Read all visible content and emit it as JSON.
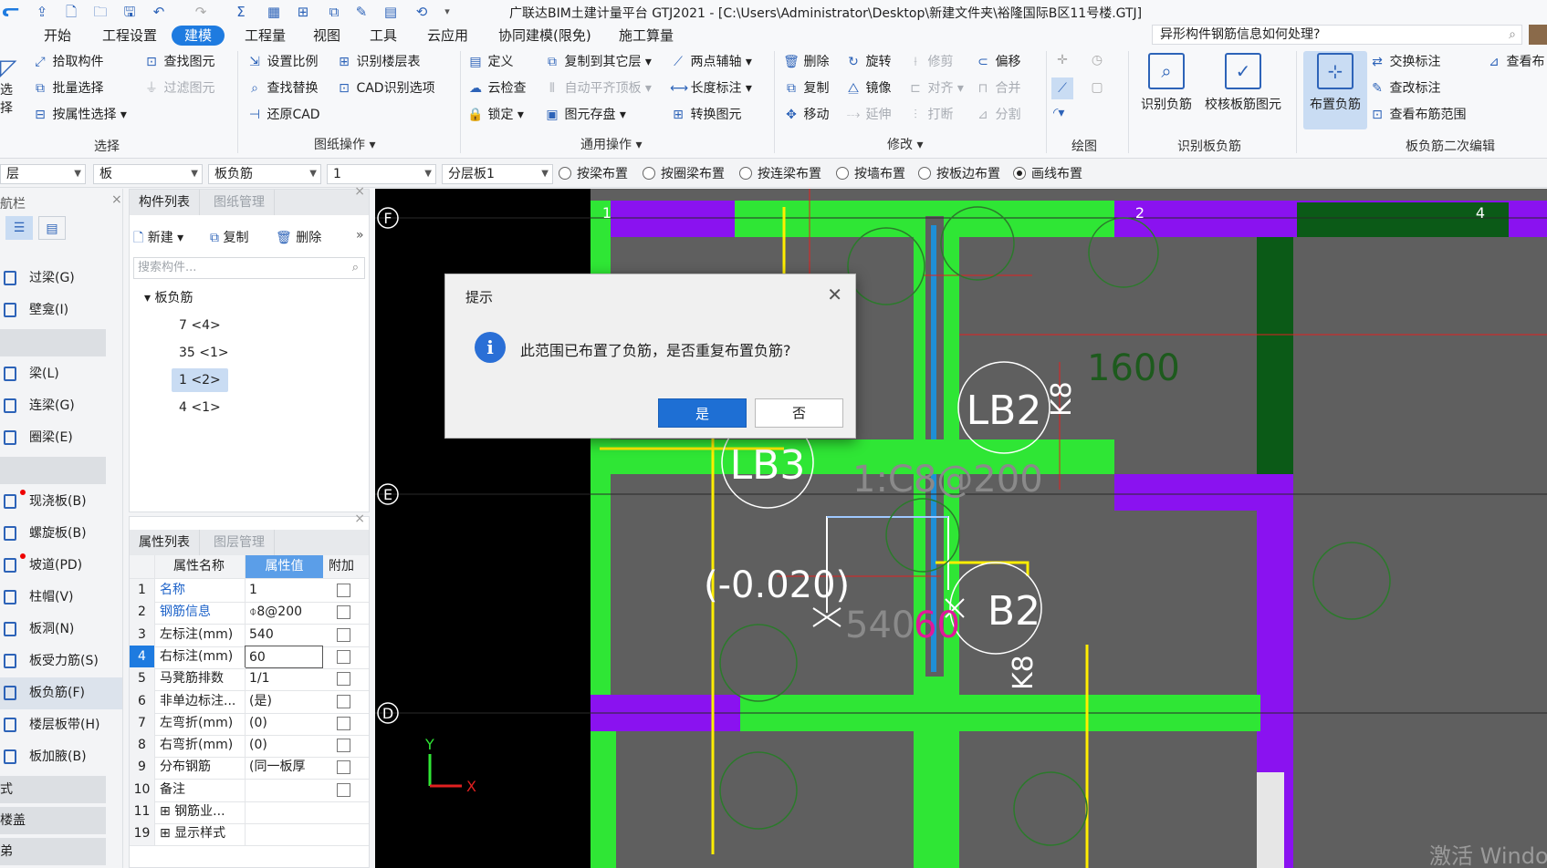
{
  "window": {
    "title": "广联达BIM土建计量平台 GTJ2021 - [C:\\Users\\Administrator\\Desktop\\新建文件夹\\裕隆国际B区11号楼.GTJ]"
  },
  "menu": [
    "开始",
    "工程设置",
    "建模",
    "工程量",
    "视图",
    "工具",
    "云应用",
    "协同建模(限免)",
    "施工算量"
  ],
  "help_search": "异形构件钢筋信息如何处理?",
  "ribbon": {
    "select": {
      "b0": "拾取构件",
      "b1": "批量选择",
      "b2": "按属性选择",
      "b3": "查找图元",
      "b4": "过滤图元",
      "group": "选择",
      "left": "选择"
    },
    "drawing": {
      "b0": "设置比例",
      "b1": "识别楼层表",
      "b2": "查找替换",
      "b3": "CAD识别选项",
      "b4": "还原CAD",
      "group": "图纸操作"
    },
    "common": {
      "b0": "定义",
      "b1": "复制到其它层",
      "b2": "两点辅轴",
      "b3": "云检查",
      "b4": "自动平齐顶板",
      "b5": "长度标注",
      "b6": "锁定",
      "b7": "图元存盘",
      "b8": "转换图元",
      "group": "通用操作"
    },
    "modify": {
      "b0": "删除",
      "b1": "旋转",
      "b2": "修剪",
      "b3": "偏移",
      "b4": "复制",
      "b5": "镜像",
      "b6": "对齐",
      "b7": "合并",
      "b8": "移动",
      "b9": "延伸",
      "b10": "打断",
      "b11": "分割",
      "group": "修改"
    },
    "draw": {
      "group": "绘图"
    },
    "recognize": {
      "b0": "识别负筋",
      "b1": "校核板筋图元",
      "group": "识别板负筋"
    },
    "secondary": {
      "b0": "布置负筋",
      "b1": "交换标注",
      "b2": "查改标注",
      "b3": "查看布筋范围",
      "b4": "查看布",
      "group": "板负筋二次编辑"
    }
  },
  "filterbar": {
    "c0": "层",
    "c1": "板",
    "c2": "板负筋",
    "c3": "1",
    "c4": "分层板1",
    "radios": [
      "按梁布置",
      "按圈梁布置",
      "按连梁布置",
      "按墙布置",
      "按板边布置",
      "画线布置"
    ],
    "selected": "画线布置"
  },
  "nav": {
    "title": "航栏",
    "items": [
      "过梁(G)",
      "壁龛(I)",
      "梁(L)",
      "连梁(G)",
      "圈梁(E)",
      "现浇板(B)",
      "螺旋板(B)",
      "坡道(PD)",
      "柱帽(V)",
      "板洞(N)",
      "板受力筋(S)",
      "板负筋(F)",
      "楼层板带(H)",
      "板加腋(B)"
    ],
    "bottom": [
      "式",
      "楼盖",
      "弟"
    ],
    "selected": "板负筋(F)"
  },
  "component_panel": {
    "tabs": [
      "构件列表",
      "图纸管理"
    ],
    "new": "新建",
    "copy": "复制",
    "delete": "删除",
    "search_placeholder": "搜索构件...",
    "root": "板负筋",
    "items": [
      "7 <4>",
      "35 <1>",
      "1 <2>",
      "4 <1>"
    ],
    "selected": "1 <2>"
  },
  "property_panel": {
    "tabs": [
      "属性列表",
      "图层管理"
    ],
    "headers": [
      "属性名称",
      "属性值",
      "附加"
    ],
    "rows": [
      {
        "num": "1",
        "name": "名称",
        "value": "1"
      },
      {
        "num": "2",
        "name": "钢筋信息",
        "value": "⌽8@200"
      },
      {
        "num": "3",
        "name": "左标注(mm)",
        "value": "540"
      },
      {
        "num": "4",
        "name": "右标注(mm)",
        "value": "60"
      },
      {
        "num": "5",
        "name": "马凳筋排数",
        "value": "1/1"
      },
      {
        "num": "6",
        "name": "非单边标注...",
        "value": "(是)"
      },
      {
        "num": "7",
        "name": "左弯折(mm)",
        "value": "(0)"
      },
      {
        "num": "8",
        "name": "右弯折(mm)",
        "value": "(0)"
      },
      {
        "num": "9",
        "name": "分布钢筋",
        "value": "(同一板厚"
      },
      {
        "num": "10",
        "name": "备注",
        "value": ""
      },
      {
        "num": "11",
        "name": "⊞ 钢筋业...",
        "value": ""
      },
      {
        "num": "19",
        "name": "⊞ 显示样式",
        "value": ""
      }
    ]
  },
  "canvas": {
    "axes_rows": [
      "F",
      "E",
      "D"
    ],
    "axes_cols": [
      "1",
      "2",
      "4"
    ],
    "labels": {
      "lb2a": "LB2",
      "lb3": "LB3",
      "lb2b": "B2",
      "rebar": "1:C8@200",
      "elev": "(-0.020)",
      "dim1": "540",
      "dim2": "60",
      "n1600": "1600",
      "k8a": "K8",
      "k8b": "K8",
      "axis_x": "X",
      "axis_y": "Y"
    },
    "watermark": "激活 Windo"
  },
  "dialog": {
    "title": "提示",
    "message": "此范围已布置了负筋，是否重复布置负筋?",
    "yes": "是",
    "no": "否"
  },
  "colors": {
    "accent": "#1e7be0",
    "beam_green": "#2fe635",
    "beam_purple": "#8a12f0",
    "dark_green": "#0b5a17"
  }
}
